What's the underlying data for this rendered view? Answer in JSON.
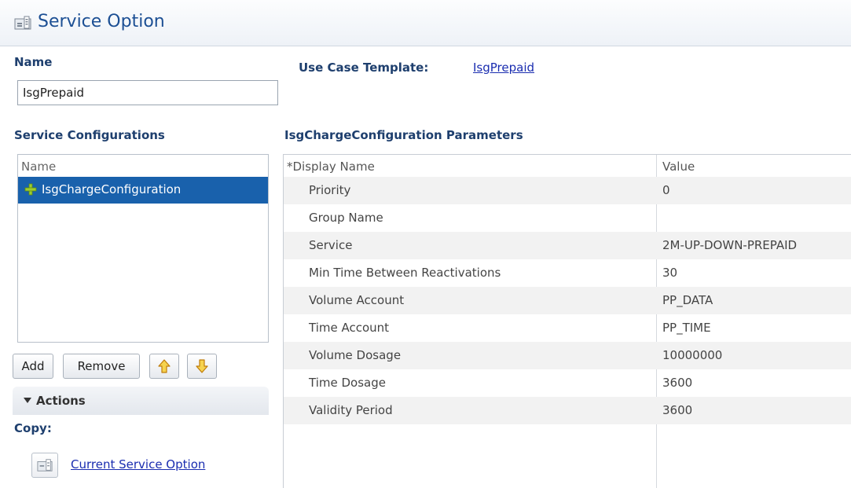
{
  "header": {
    "title": "Service Option"
  },
  "name_section": {
    "label": "Name",
    "value": "IsgPrepaid"
  },
  "use_case": {
    "label": "Use Case Template:",
    "link": "IsgPrepaid"
  },
  "service_configs": {
    "heading": "Service Configurations",
    "column_header": "Name",
    "items": [
      "IsgChargeConfiguration"
    ]
  },
  "buttons": {
    "add": "Add",
    "remove": "Remove"
  },
  "actions": {
    "title": "Actions",
    "copy_label": "Copy:",
    "copy_link": "Current Service Option"
  },
  "params": {
    "heading": "IsgChargeConfiguration Parameters",
    "col_name": "*Display Name",
    "col_value": "Value",
    "rows": [
      {
        "name": "Priority",
        "value": "0"
      },
      {
        "name": "Group Name",
        "value": ""
      },
      {
        "name": "Service",
        "value": "2M-UP-DOWN-PREPAID"
      },
      {
        "name": "Min Time Between Reactivations",
        "value": "30"
      },
      {
        "name": "Volume Account",
        "value": "PP_DATA"
      },
      {
        "name": "Time Account",
        "value": "PP_TIME"
      },
      {
        "name": "Volume Dosage",
        "value": "10000000"
      },
      {
        "name": "Time Dosage",
        "value": "3600"
      },
      {
        "name": "Validity Period",
        "value": "3600"
      }
    ]
  }
}
